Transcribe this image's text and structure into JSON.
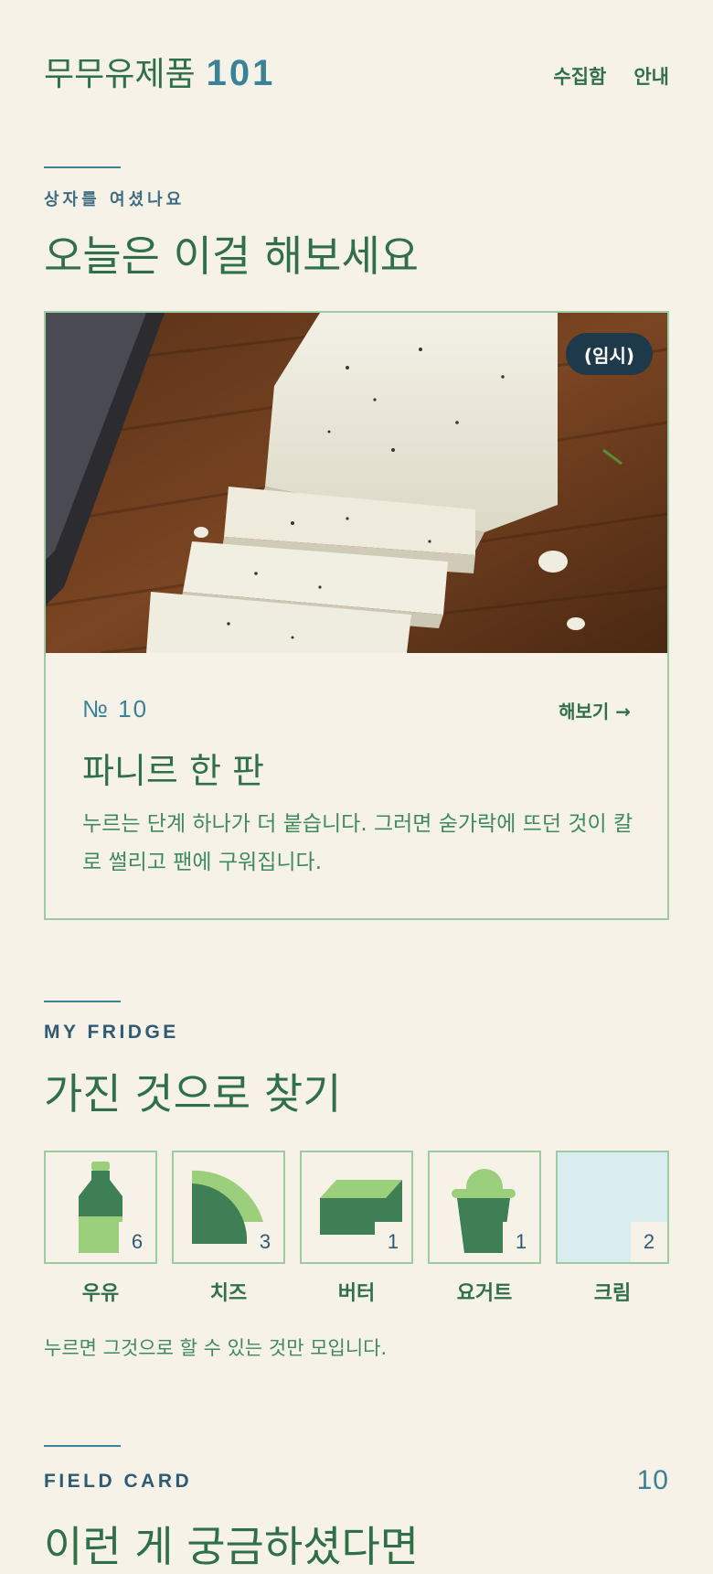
{
  "header": {
    "brand_name": "무무유제품",
    "brand_number": "101",
    "nav": [
      {
        "label": "수집함"
      },
      {
        "label": "안내"
      }
    ]
  },
  "today": {
    "kicker": "상자를 여셨나요",
    "heading": "오늘은 이걸 해보세요",
    "card": {
      "badge": "(임시)",
      "number": "№ 10",
      "link": "해보기 →",
      "title": "파니르 한 판",
      "description": "누르는 단계 하나가 더 붙습니다. 그러면 숟가락에 뜨던 것이 칼로 썰리고 팬에 구워집니다."
    }
  },
  "fridge": {
    "kicker": "MY FRIDGE",
    "heading": "가진 것으로 찾기",
    "items": [
      {
        "label": "우유",
        "count": "6",
        "icon": "milk-bottle-icon"
      },
      {
        "label": "치즈",
        "count": "3",
        "icon": "cheese-wedge-icon"
      },
      {
        "label": "버터",
        "count": "1",
        "icon": "butter-block-icon"
      },
      {
        "label": "요거트",
        "count": "1",
        "icon": "yogurt-cup-icon"
      },
      {
        "label": "크림",
        "count": "2",
        "icon": "cream-icon"
      }
    ],
    "hint": "누르면 그것으로 할 수 있는 것만 모입니다."
  },
  "field_card": {
    "kicker": "FIELD CARD",
    "count": "10",
    "heading": "이런 게 궁금하셨다면"
  },
  "colors": {
    "background": "#f7f2e7",
    "green": "#2f6f4a",
    "accent_teal": "#3a8298",
    "border": "#9ccba5",
    "badge_bg": "#1e3a4a"
  }
}
